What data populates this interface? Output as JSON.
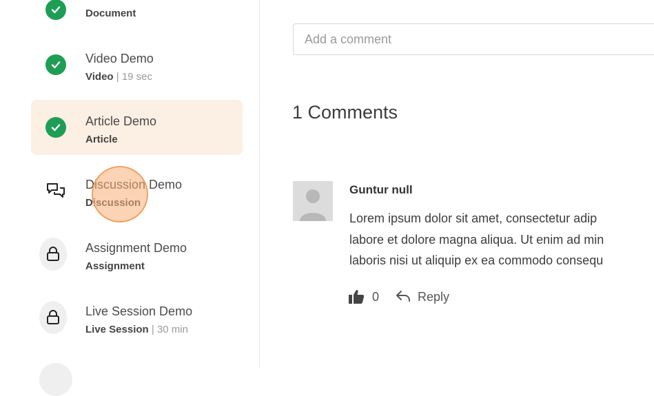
{
  "sidebar": {
    "lessons": [
      {
        "title": "",
        "type": "Document",
        "duration": "",
        "status": "complete"
      },
      {
        "title": "Video Demo",
        "type": "Video",
        "duration": "19 sec",
        "status": "complete"
      },
      {
        "title": "Article Demo",
        "type": "Article",
        "duration": "",
        "status": "complete"
      },
      {
        "title": "Discussion Demo",
        "type": "Discussion",
        "duration": "",
        "status": "discussion"
      },
      {
        "title": "Assignment Demo",
        "type": "Assignment",
        "duration": "",
        "status": "locked"
      },
      {
        "title": "Live Session Demo",
        "type": "Live Session",
        "duration": "30 min",
        "status": "locked"
      }
    ]
  },
  "comment_form": {
    "placeholder": "Add a comment"
  },
  "comments": {
    "count_label": "1 Comments",
    "items": [
      {
        "author": "Guntur null",
        "lines": [
          "Lorem ipsum dolor sit amet, consectetur adip",
          "labore et dolore magna aliqua. Ut enim ad min",
          "laboris nisi ut aliquip ex ea commodo consequ"
        ],
        "likes": "0",
        "reply_label": "Reply"
      }
    ]
  },
  "colors": {
    "complete": "#1e9e55",
    "active_bg": "#fcefe3",
    "cursor": "#f0a060"
  }
}
